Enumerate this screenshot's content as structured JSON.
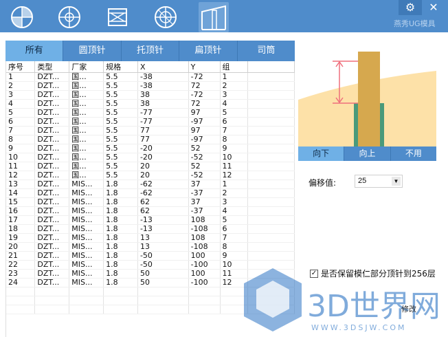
{
  "toolbar": {
    "tools": [
      {
        "icon": "circle-sector-icon"
      },
      {
        "icon": "circle-cross-icon"
      },
      {
        "icon": "box-x-icon"
      },
      {
        "icon": "circle-grid-icon"
      },
      {
        "icon": "ejector-pin-icon"
      }
    ],
    "brand": "燕秀UG模具"
  },
  "tabs": [
    "所有",
    "圆顶针",
    "托顶针",
    "扁顶针",
    "司筒"
  ],
  "table": {
    "headers": [
      "序号",
      "类型",
      "厂家",
      "规格",
      "X",
      "Y",
      "组"
    ],
    "rows": [
      [
        "1",
        "DZT...",
        "国...",
        "5.5",
        "-38",
        "-72",
        "1"
      ],
      [
        "2",
        "DZT...",
        "国...",
        "5.5",
        "-38",
        "72",
        "2"
      ],
      [
        "3",
        "DZT...",
        "国...",
        "5.5",
        "38",
        "-72",
        "3"
      ],
      [
        "4",
        "DZT...",
        "国...",
        "5.5",
        "38",
        "72",
        "4"
      ],
      [
        "5",
        "DZT...",
        "国...",
        "5.5",
        "-77",
        "97",
        "5"
      ],
      [
        "6",
        "DZT...",
        "国...",
        "5.5",
        "-77",
        "-97",
        "6"
      ],
      [
        "7",
        "DZT...",
        "国...",
        "5.5",
        "77",
        "97",
        "7"
      ],
      [
        "8",
        "DZT...",
        "国...",
        "5.5",
        "77",
        "-97",
        "8"
      ],
      [
        "9",
        "DZT...",
        "国...",
        "5.5",
        "-20",
        "52",
        "9"
      ],
      [
        "10",
        "DZT...",
        "国...",
        "5.5",
        "-20",
        "-52",
        "10"
      ],
      [
        "11",
        "DZT...",
        "国...",
        "5.5",
        "20",
        "52",
        "11"
      ],
      [
        "12",
        "DZT...",
        "国...",
        "5.5",
        "20",
        "-52",
        "12"
      ],
      [
        "13",
        "DZT...",
        "MIS...",
        "1.8",
        "-62",
        "37",
        "1"
      ],
      [
        "14",
        "DZT...",
        "MIS...",
        "1.8",
        "-62",
        "-37",
        "2"
      ],
      [
        "15",
        "DZT...",
        "MIS...",
        "1.8",
        "62",
        "37",
        "3"
      ],
      [
        "16",
        "DZT...",
        "MIS...",
        "1.8",
        "62",
        "-37",
        "4"
      ],
      [
        "17",
        "DZT...",
        "MIS...",
        "1.8",
        "-13",
        "108",
        "5"
      ],
      [
        "18",
        "DZT...",
        "MIS...",
        "1.8",
        "-13",
        "-108",
        "6"
      ],
      [
        "19",
        "DZT...",
        "MIS...",
        "1.8",
        "13",
        "108",
        "7"
      ],
      [
        "20",
        "DZT...",
        "MIS...",
        "1.8",
        "13",
        "-108",
        "8"
      ],
      [
        "21",
        "DZT...",
        "MIS...",
        "1.8",
        "-50",
        "100",
        "9"
      ],
      [
        "22",
        "DZT...",
        "MIS...",
        "1.8",
        "-50",
        "-100",
        "10"
      ],
      [
        "23",
        "DZT...",
        "MIS...",
        "1.8",
        "50",
        "100",
        "11"
      ],
      [
        "24",
        "DZT...",
        "MIS...",
        "1.8",
        "50",
        "-100",
        "12"
      ]
    ]
  },
  "direction_tabs": [
    "向下",
    "向上",
    "不用"
  ],
  "offset": {
    "label": "偏移值:",
    "value": "25"
  },
  "keep_option": {
    "label": "是否保留模仁部分顶针到256层",
    "checked": true
  },
  "modify_button": "修改",
  "watermark": {
    "text": "3D世界网",
    "url": "WWW.3DSJW.COM"
  },
  "colors": {
    "accent": "#4f8ccb",
    "active_tab": "#6fb0e6",
    "diagram_bg": "#fde1a8",
    "pin": "#d6a84e",
    "sleeve": "#4a9a7a",
    "arrow": "#ef6f7c"
  }
}
